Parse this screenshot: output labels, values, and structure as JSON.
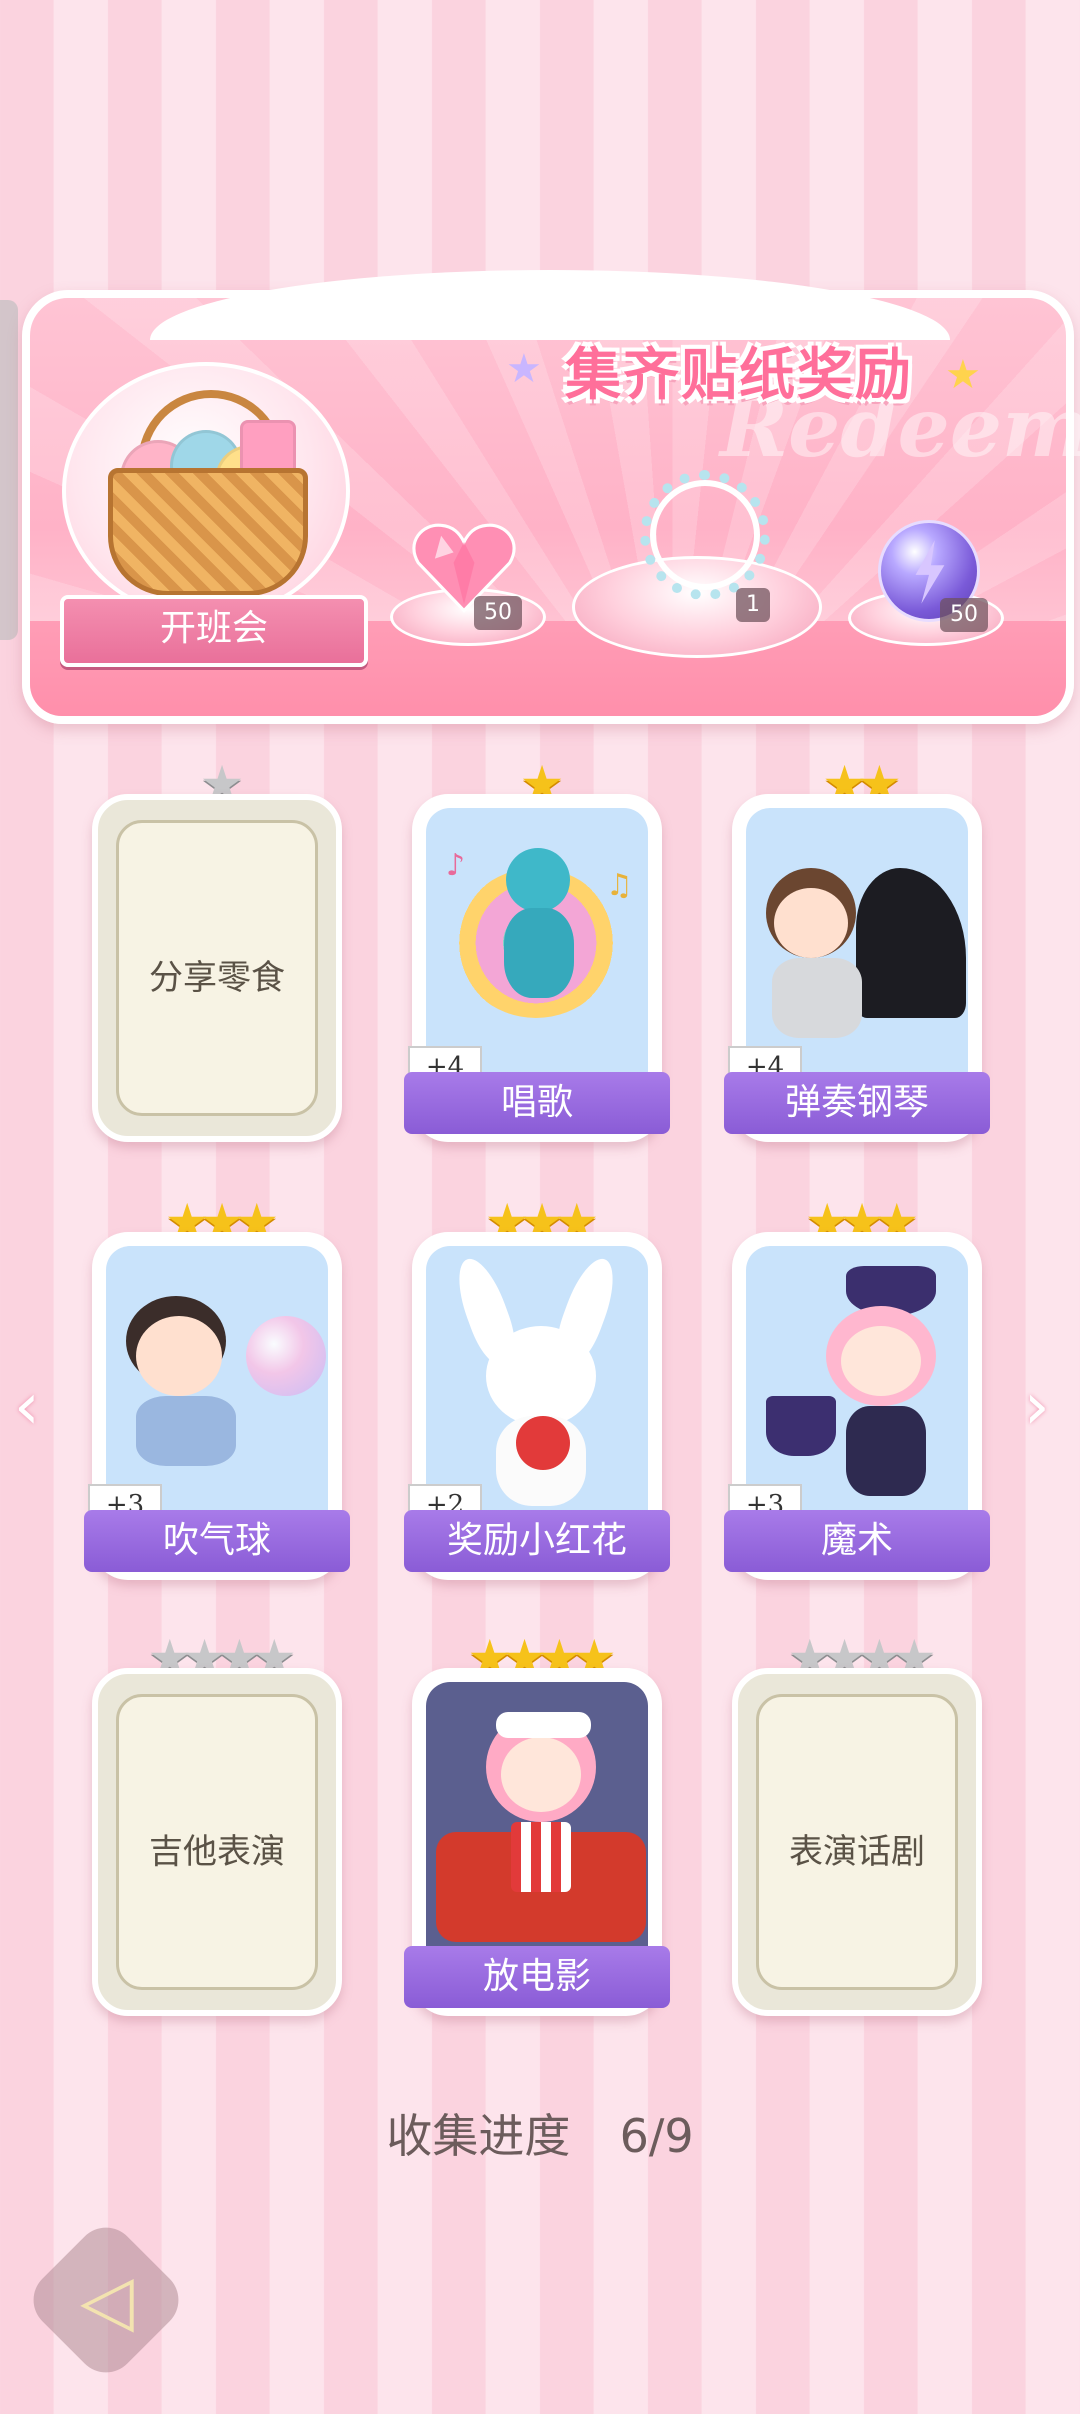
{
  "banner": {
    "title": "集齐贴纸奖励",
    "watermark": "Redeem",
    "event_label": "开班会",
    "rewards": [
      {
        "icon": "pink-heart-gem-icon",
        "qty": "50"
      },
      {
        "icon": "bead-bracelet-icon",
        "qty": "1"
      },
      {
        "icon": "purple-energy-orb-icon",
        "qty": "50"
      }
    ]
  },
  "stickers": [
    {
      "name": "分享零食",
      "stars": 1,
      "unlocked": false,
      "bonus": ""
    },
    {
      "name": "唱歌",
      "stars": 1,
      "unlocked": true,
      "bonus": "+4",
      "art": "peacock-singer"
    },
    {
      "name": "弹奏钢琴",
      "stars": 2,
      "unlocked": true,
      "bonus": "+4",
      "art": "boy-piano"
    },
    {
      "name": "吹气球",
      "stars": 3,
      "unlocked": true,
      "bonus": "+3",
      "art": "boy-bubble"
    },
    {
      "name": "奖励小红花",
      "stars": 3,
      "unlocked": true,
      "bonus": "+2",
      "art": "bunny-flower"
    },
    {
      "name": "魔术",
      "stars": 3,
      "unlocked": true,
      "bonus": "+3",
      "art": "girl-magician"
    },
    {
      "name": "吉他表演",
      "stars": 4,
      "unlocked": false,
      "bonus": ""
    },
    {
      "name": "放电影",
      "stars": 4,
      "unlocked": true,
      "bonus": "",
      "art": "girl-popcorn"
    },
    {
      "name": "表演话剧",
      "stars": 4,
      "unlocked": false,
      "bonus": ""
    }
  ],
  "progress": {
    "label": "收集进度",
    "value": "6/9"
  },
  "icons": {
    "prev": "chevron-left-icon",
    "next": "chevron-right-icon",
    "back": "back-arrow-icon"
  },
  "colors": {
    "ribbon": "#9a6ce0",
    "banner_pink": "#ffb2c7",
    "star_gold": "#f6c21a",
    "locked_card": "#eae7d9"
  }
}
